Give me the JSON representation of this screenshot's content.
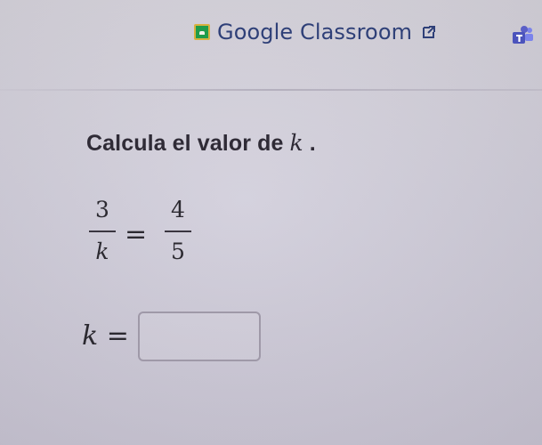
{
  "header": {
    "classroom_link": {
      "label": "Google Classroom",
      "icon": "google-classroom-logo",
      "external_icon": "external-link-icon"
    },
    "integration_icon": "teams-icon"
  },
  "problem": {
    "prompt_text": "Calcula el valor de ",
    "prompt_variable": "k",
    "prompt_period": ".",
    "equation": {
      "left_numerator": "3",
      "left_denominator": "k",
      "equals": "=",
      "right_numerator": "4",
      "right_denominator": "5"
    },
    "answer": {
      "label": "k =",
      "value": "",
      "placeholder": ""
    }
  },
  "colors": {
    "background": "#d1cedb",
    "link": "#2f4078",
    "text": "#2d2b33",
    "input_border": "#9f99a8",
    "classroom_green": "#1f9c4a",
    "classroom_yellow": "#d7b13f",
    "teams_purple": "#5b5fc7"
  }
}
